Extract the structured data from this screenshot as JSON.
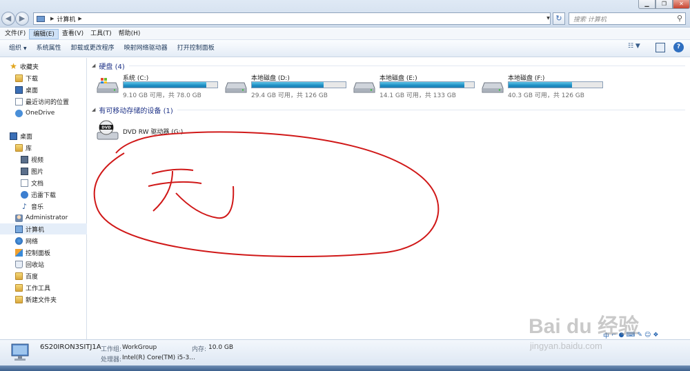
{
  "window": {
    "address_location": "计算机",
    "search_placeholder": "搜索 计算机",
    "back_icon": "back-arrow-icon",
    "forward_icon": "forward-arrow-icon"
  },
  "menu": {
    "file": "文件(F)",
    "edit": "编辑(E)",
    "view": "查看(V)",
    "tools": "工具(T)",
    "help": "帮助(H)"
  },
  "toolbar": {
    "organize": "组织",
    "system_properties": "系统属性",
    "uninstall": "卸载或更改程序",
    "map_drive": "映射网络驱动器",
    "control_panel": "打开控制面板"
  },
  "sidebar": {
    "favorites": "收藏夹",
    "downloads": "下载",
    "desktop_fav": "桌面",
    "recent": "最近访问的位置",
    "onedrive": "OneDrive",
    "desktop": "桌面",
    "libraries": "库",
    "videos": "视频",
    "pictures": "图片",
    "documents": "文档",
    "xunlei": "迅雷下载",
    "music": "音乐",
    "administrator": "Administrator",
    "computer": "计算机",
    "network": "网络",
    "control_panel": "控制面板",
    "recycle_bin": "回收站",
    "baidu": "百度",
    "work_tools": "工作工具",
    "new_folder": "新建文件夹"
  },
  "content": {
    "hard_disks_header": "硬盘 (4)",
    "removable_header": "有可移动存储的设备 (1)",
    "drives": [
      {
        "name": "系统 (C:)",
        "sizes": "9.10 GB 可用，共 78.0 GB",
        "used_fraction": 0.883
      },
      {
        "name": "本地磁盘 (D:)",
        "sizes": "29.4 GB 可用，共 126 GB",
        "used_fraction": 0.767
      },
      {
        "name": "本地磁盘 (E:)",
        "sizes": "14.1 GB 可用，共 133 GB",
        "used_fraction": 0.894
      },
      {
        "name": "本地磁盘 (F:)",
        "sizes": "40.3 GB 可用，共 126 GB",
        "used_fraction": 0.68
      }
    ],
    "dvd": {
      "name": "DVD RW 驱动器 (G:)",
      "disc_label": "DVD"
    },
    "annotation_text": "无"
  },
  "details": {
    "computer_name": "6S20IRON3SITJ1A",
    "workgroup_label": "工作组:",
    "workgroup": "WorkGroup",
    "memory_label": "内存:",
    "memory": "10.0 GB",
    "processor_label": "处理器:",
    "processor": "Intel(R) Core(TM) i5-3..."
  },
  "ime": {
    "mode": "中"
  },
  "watermark": {
    "logo": "Bai du 经验",
    "site": "jingyan.baidu.com"
  },
  "colors": {
    "drive_bar": "#1f8fc4",
    "group_header": "#1e3287",
    "scribble": "#d01818"
  }
}
